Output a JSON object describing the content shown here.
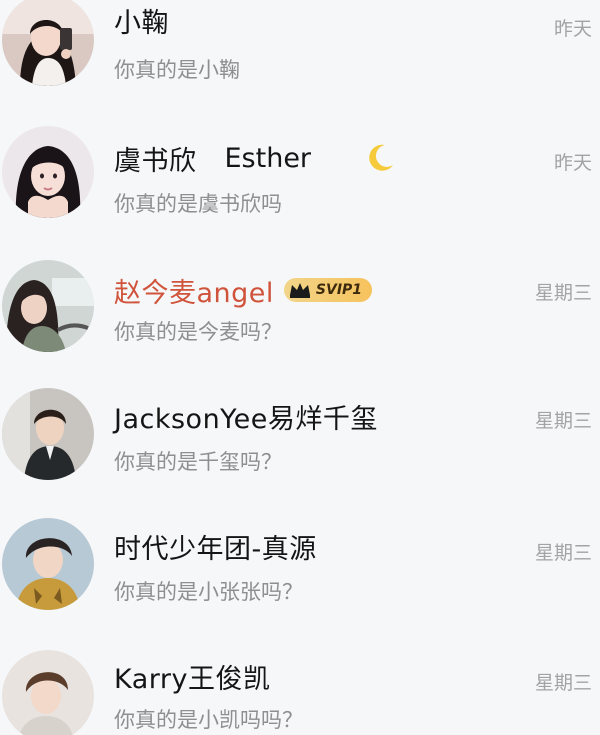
{
  "conversations": [
    {
      "name": "小鞠",
      "name_extra": "",
      "last_message": "你真的是小鞠",
      "time": "昨天",
      "name_color": "#151515",
      "badge": "",
      "avatar_icon": "woman-selfie-avatar-icon"
    },
    {
      "name": "虞书欣",
      "name_extra": "Esther",
      "last_message": "你真的是虞书欣吗",
      "time": "昨天",
      "name_color": "#151515",
      "badge": "",
      "status_icon": "crescent-moon-icon",
      "avatar_icon": "woman-portrait-avatar-icon"
    },
    {
      "name": "赵今麦angel",
      "name_extra": "",
      "last_message": "你真的是今麦吗？",
      "time": "星期三",
      "name_color": "#d0543c",
      "badge": "SVIP1",
      "avatar_icon": "woman-in-car-avatar-icon"
    },
    {
      "name": "JacksonYee易烊千玺",
      "name_extra": "",
      "last_message": "你真的是千玺吗？",
      "time": "星期三",
      "name_color": "#151515",
      "badge": "",
      "avatar_icon": "man-in-suit-avatar-icon"
    },
    {
      "name": "时代少年团-真源",
      "name_extra": "",
      "last_message": "你真的是小张张吗？",
      "time": "星期三",
      "name_color": "#151515",
      "badge": "",
      "avatar_icon": "young-man-avatar-icon"
    },
    {
      "name": "Karry王俊凯",
      "name_extra": "",
      "last_message": "你真的是小凯吗吗？",
      "time": "星期三",
      "name_color": "#151515",
      "badge": "",
      "avatar_icon": "young-man-portrait-avatar-icon"
    }
  ]
}
